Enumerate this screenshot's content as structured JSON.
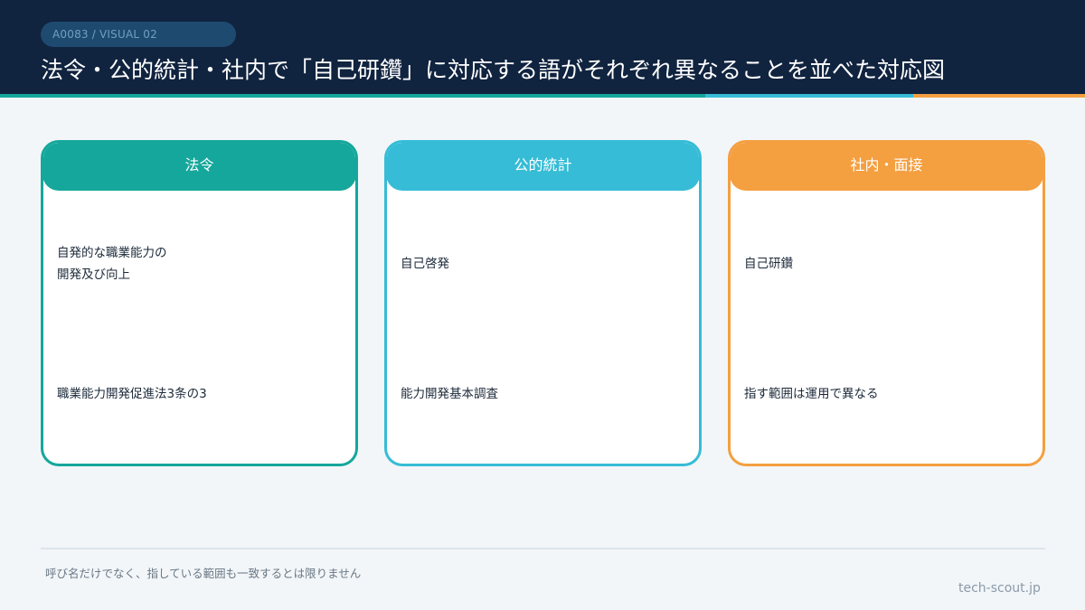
{
  "header": {
    "tag": "A0083 / VISUAL 02",
    "title": "法令・公的統計・社内で「自己研鑽」に対応する語がそれぞれ異なることを並べた対応図"
  },
  "colors": {
    "header_bg": "#10233f",
    "teal": "#15a79b",
    "cyan": "#36bcd6",
    "orange": "#f49f40"
  },
  "columns": [
    {
      "label": "法令",
      "term_line1": "自発的な職業能力の",
      "term_line2": "開発及び向上",
      "source": "職業能力開発促進法3条の3"
    },
    {
      "label": "公的統計",
      "term": "自己啓発",
      "source": "能力開発基本調査"
    },
    {
      "label": "社内・面接",
      "term": "自己研鑽",
      "source": "指す範囲は運用で異なる"
    }
  ],
  "footer": {
    "note": "呼び名だけでなく、指している範囲も一致するとは限りません",
    "brand": "tech-scout.jp"
  }
}
